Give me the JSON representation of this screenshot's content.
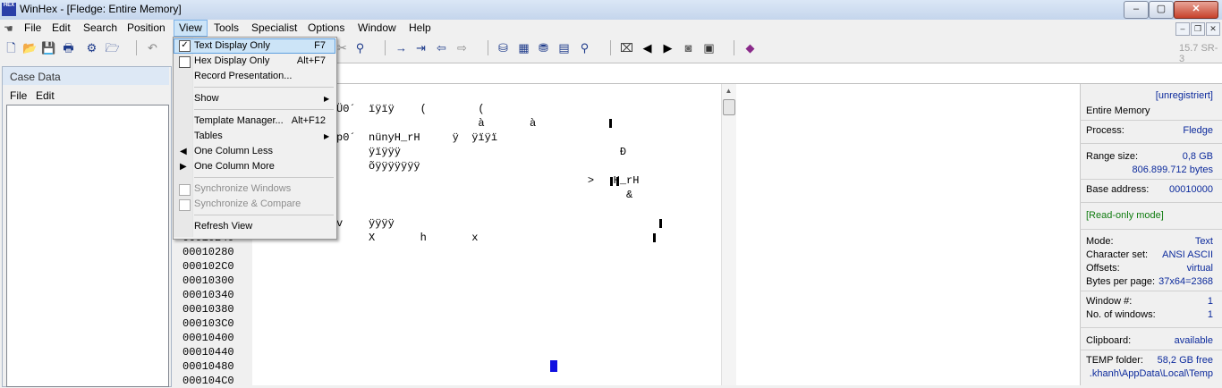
{
  "window": {
    "title": "WinHex - [Fledge: Entire Memory]",
    "app_icon_text": "HEX",
    "version": "15.7 SR-3"
  },
  "window_controls": {
    "minimize": "–",
    "maximize": "▢",
    "close": "✕",
    "mdi_minimize": "–",
    "mdi_restore": "❐",
    "mdi_close": "✕"
  },
  "menubar": [
    "File",
    "Edit",
    "Search",
    "Position",
    "View",
    "Tools",
    "Specialist",
    "Options",
    "Window",
    "Help"
  ],
  "menubar_active": "View",
  "view_menu": {
    "items": [
      {
        "label": "Text Display Only",
        "shortcut": "F7",
        "checked": true,
        "highlighted": true
      },
      {
        "label": "Hex Display Only",
        "shortcut": "Alt+F7",
        "checked": false
      },
      {
        "label": "Record Presentation..."
      },
      {
        "label": "Show",
        "submenu": true
      },
      {
        "label": "Template Manager...",
        "shortcut": "Alt+F12"
      },
      {
        "label": "Tables",
        "submenu": true
      },
      {
        "label": "One Column Less",
        "icon": "triangle-left-icon"
      },
      {
        "label": "One Column More",
        "icon": "triangle-right-icon"
      },
      {
        "label": "Synchronize Windows",
        "disabled": true
      },
      {
        "label": "Synchronize & Compare",
        "disabled": true
      },
      {
        "label": "Refresh View"
      }
    ]
  },
  "case_data": {
    "title": "Case Data",
    "menu": [
      "File",
      "Edit"
    ]
  },
  "offsets": [
    "00010240",
    "00010280",
    "000102C0",
    "00010300",
    "00010340",
    "00010380",
    "000103C0",
    "00010400",
    "00010440",
    "00010480",
    "000104C0"
  ],
  "text_rows": [
    {
      "text": "Ü0´  ïÿïÿ    (        ("
    },
    {
      "text": "                      à       à"
    },
    {
      "text": "p0´  nünyH_rH     ÿ  ÿïÿï"
    },
    {
      "text": "     ÿïÿÿÿ                                  Ð"
    },
    {
      "text": "     õÿÿÿÿÿÿÿ"
    },
    {
      "text": "                                       >   H_rH"
    },
    {
      "text": "                                             &"
    },
    {
      "text": ""
    },
    {
      "text": "v    ÿÿÿÿ"
    },
    {
      "text": "     X       h       x"
    }
  ],
  "info": {
    "registration": "[unregistriert]",
    "object": "Entire Memory",
    "process_label": "Process:",
    "process_value": "Fledge",
    "range_label": "Range size:",
    "range_value": "0,8 GB",
    "range_bytes": "806.899.712 bytes",
    "base_label": "Base address:",
    "base_value": "00010000",
    "readonly": "[Read-only mode]",
    "mode_label": "Mode:",
    "mode_value": "Text",
    "charset_label": "Character set:",
    "charset_value": "ANSI ASCII",
    "offsets_label": "Offsets:",
    "offsets_value": "virtual",
    "bpp_label": "Bytes per page:",
    "bpp_value": "37x64=2368",
    "window_label": "Window #:",
    "window_value": "1",
    "nwin_label": "No. of windows:",
    "nwin_value": "1",
    "clip_label": "Clipboard:",
    "clip_value": "available",
    "temp_label": "TEMP folder:",
    "temp_value": "58,2 GB free",
    "temp_path": ".khanh\\AppData\\Local\\Temp"
  },
  "colors": {
    "accent": "#0c2a9c",
    "readonly": "#107c10",
    "highlight": "#cce4f7",
    "cursor": "#1010e0"
  }
}
